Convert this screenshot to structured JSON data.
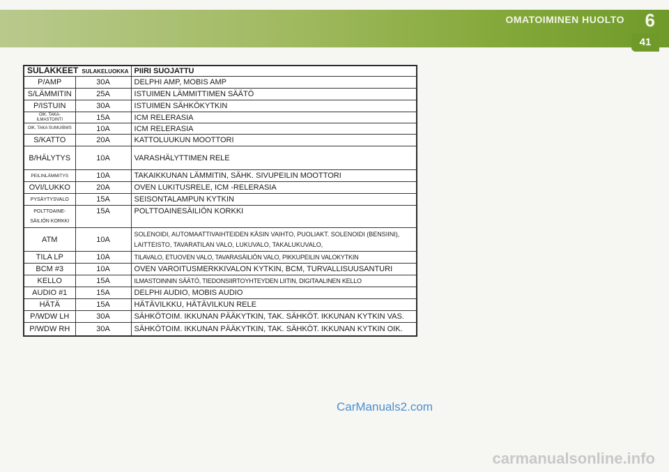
{
  "header": {
    "chapter_title": "OMATOIMINEN HUOLTO",
    "chapter_number": "6",
    "page_number": "41"
  },
  "table": {
    "header_main": "SULAKKEET",
    "header_sub": "SULAKELUOKKA",
    "header_circuit": "PIIRI SUOJATTU",
    "rows": [
      {
        "name": "P/AMP",
        "amp": "30A",
        "desc": "DELPHI AMP, MOBIS AMP"
      },
      {
        "name": "S/LÄMMITIN",
        "amp": "25A",
        "desc": "ISTUIMEN LÄMMITTIMEN SÄÄTÖ"
      },
      {
        "name": "P/ISTUIN",
        "amp": "30A",
        "desc": "ISTUIMEN SÄHKÖKYTKIN"
      },
      {
        "name": "OIK. TAKA-ILMASTOINTI",
        "amp": "15A",
        "desc": "ICM RELERASIA"
      },
      {
        "name": "OIK. TAKA SUMU/BWS",
        "amp": "10A",
        "desc": "ICM RELERASIA"
      },
      {
        "name": "S/KATTO",
        "amp": "20A",
        "desc": "KATTOLUUKUN MOOTTORI"
      },
      {
        "name": "B/HÄLYTYS",
        "amp": "10A",
        "desc": "VARASHÄLYTTIMEN RELE"
      },
      {
        "name": "PEILINLÄMMITYS",
        "amp": "10A",
        "desc": "TAKAIKKUNAN LÄMMITIN, SÄHK. SIVUPEILIN MOOTTORI"
      },
      {
        "name": "OVI/LUKKO",
        "amp": "20A",
        "desc": "OVEN LUKITUSRELE, ICM -RELERASIA"
      },
      {
        "name": "PYSÄYTYSVALO",
        "amp": "15A",
        "desc": "SEISONTALAMPUN KYTKIN"
      },
      {
        "name": "POLTTOAINE-SÄILIÖN KORKKI",
        "amp": "15A",
        "desc": "POLTTOAINESÄILIÖN KORKKI"
      },
      {
        "name": "ATM",
        "amp": "10A",
        "desc": "SOLENOIDI, AUTOMAATTIVAIHTEIDEN KÄSIN VAIHTO, PUOLIAKT. SOLENOIDI (BENSIINI), LAITTEISTO, TAVARATILAN VALO, LUKUVALO, TAKALUKUVALO,"
      },
      {
        "name": "TILA LP",
        "amp": "10A",
        "desc": "TILAVALO, ETUOVEN VALO, TAVARASÄILIÖN VALO, PIKKUPEILIN VALOKYTKIN"
      },
      {
        "name": "BCM #3",
        "amp": "10A",
        "desc": "OVEN VAROITUSMERKKIVALON KYTKIN, BCM, TURVALLISUUSANTURI"
      },
      {
        "name": "KELLO",
        "amp": "15A",
        "desc": "ILMASTOINNIN SÄÄTÖ, TIEDONSIIRTOYHTEYDEN LIITIN, DIGITAALINEN KELLO"
      },
      {
        "name": "AUDIO #1",
        "amp": "15A",
        "desc": "DELPHI AUDIO, MOBIS AUDIO"
      },
      {
        "name": "HÄTÄ",
        "amp": "15A",
        "desc": "HÄTÄVILKKU, HÄTÄVILKUN RELE"
      },
      {
        "name": "P/WDW LH",
        "amp": "30A",
        "desc": "SÄHKÖTOIM. IKKUNAN PÄÄKYTKIN, TAK. SÄHKÖT. IKKUNAN KYTKIN VAS."
      },
      {
        "name": "P/WDW RH",
        "amp": "30A",
        "desc": "SÄHKÖTOIM. IKKUNAN PÄÄKYTKIN, TAK. SÄHKÖT. IKKUNAN KYTKIN OIK."
      }
    ]
  },
  "watermark": "CarManuals2.com",
  "footer_mark": "carmanualsonline.info"
}
